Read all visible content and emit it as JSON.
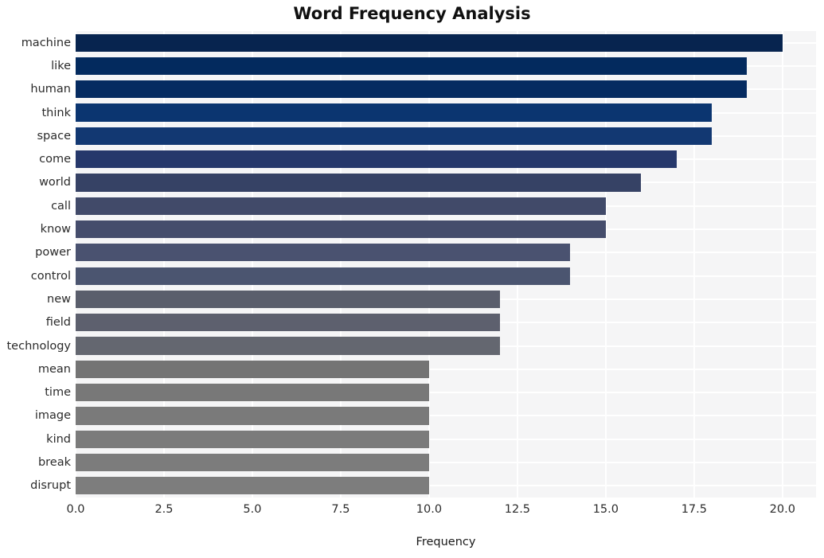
{
  "chart_data": {
    "type": "bar",
    "orientation": "horizontal",
    "title": "Word Frequency Analysis",
    "xlabel": "Frequency",
    "ylabel": "",
    "categories": [
      "machine",
      "like",
      "human",
      "think",
      "space",
      "come",
      "world",
      "call",
      "know",
      "power",
      "control",
      "new",
      "field",
      "technology",
      "mean",
      "time",
      "image",
      "kind",
      "break",
      "disrupt"
    ],
    "values": [
      20,
      19,
      19,
      18,
      18,
      17,
      16,
      15,
      15,
      14,
      14,
      12,
      12,
      12,
      10,
      10,
      10,
      10,
      10,
      10
    ],
    "bar_colors": [
      "#07244f",
      "#032a5e",
      "#052b61",
      "#0b3570",
      "#123872",
      "#26386b",
      "#364265",
      "#414a69",
      "#454d6c",
      "#4a5270",
      "#4b5570",
      "#5a5e6c",
      "#5d606e",
      "#646770",
      "#747474",
      "#787878",
      "#7a7a7a",
      "#7b7b7b",
      "#7c7c7c",
      "#7d7d7d"
    ],
    "xticks": [
      "0.0",
      "2.5",
      "5.0",
      "7.5",
      "10.0",
      "12.5",
      "15.0",
      "17.5",
      "20.0"
    ],
    "xtick_values": [
      0,
      2.5,
      5,
      7.5,
      10,
      12.5,
      15,
      17.5,
      20
    ],
    "xlim": [
      0,
      20.95
    ],
    "grid": "whitegrid",
    "plot_background": "#f5f5f6",
    "grid_color": "#ffffff",
    "figure_background": "#ffffff"
  }
}
